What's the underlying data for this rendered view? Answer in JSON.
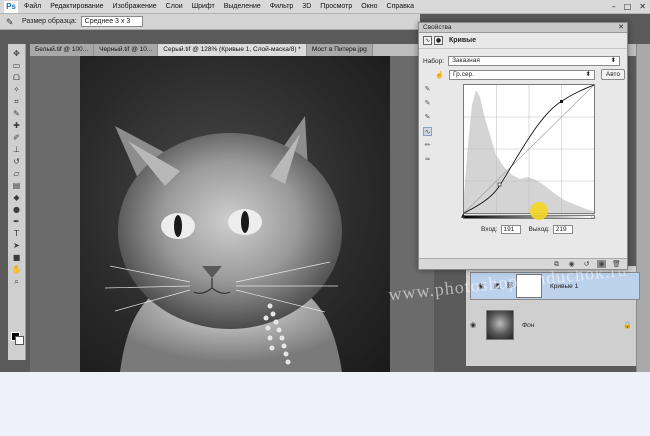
{
  "app": {
    "logo": "Ps"
  },
  "menu": [
    "Файл",
    "Редактирование",
    "Изображение",
    "Слои",
    "Шрифт",
    "Выделение",
    "Фильтр",
    "3D",
    "Просмотр",
    "Окно",
    "Справка"
  ],
  "window_controls": [
    "–",
    "□",
    "✕"
  ],
  "options_bar": {
    "label": "Размер образца:",
    "value": "Среднее 3 х 3"
  },
  "tabs": [
    {
      "label": "Белый.tif @ 100...",
      "active": false
    },
    {
      "label": "Черный.tif @ 10...",
      "active": false
    },
    {
      "label": "Серый.tif @ 128% (Кривые 1, Слой-маска/8) *",
      "active": true
    },
    {
      "label": "Мост в Питере.jpg",
      "active": false
    }
  ],
  "properties": {
    "panel_title": "Свойства",
    "close": "✕",
    "adjustment_name": "Кривые",
    "preset_label": "Набор:",
    "preset_value": "Заказная",
    "channel_value": "Гр.сер.",
    "auto_label": "Авто",
    "input_label": "Вход:",
    "input_value": "191",
    "output_label": "Выход:",
    "output_value": "219"
  },
  "layers": [
    {
      "name": "Кривые 1",
      "selected": true
    },
    {
      "name": "Фон",
      "selected": false
    }
  ],
  "watermark": "www.photoshopsunduchok.ru",
  "colors": {
    "menubar": "#d9d9d9",
    "panel": "#e8e8e8",
    "selection": "#bcd1ec",
    "cursor": "#f4d622"
  }
}
